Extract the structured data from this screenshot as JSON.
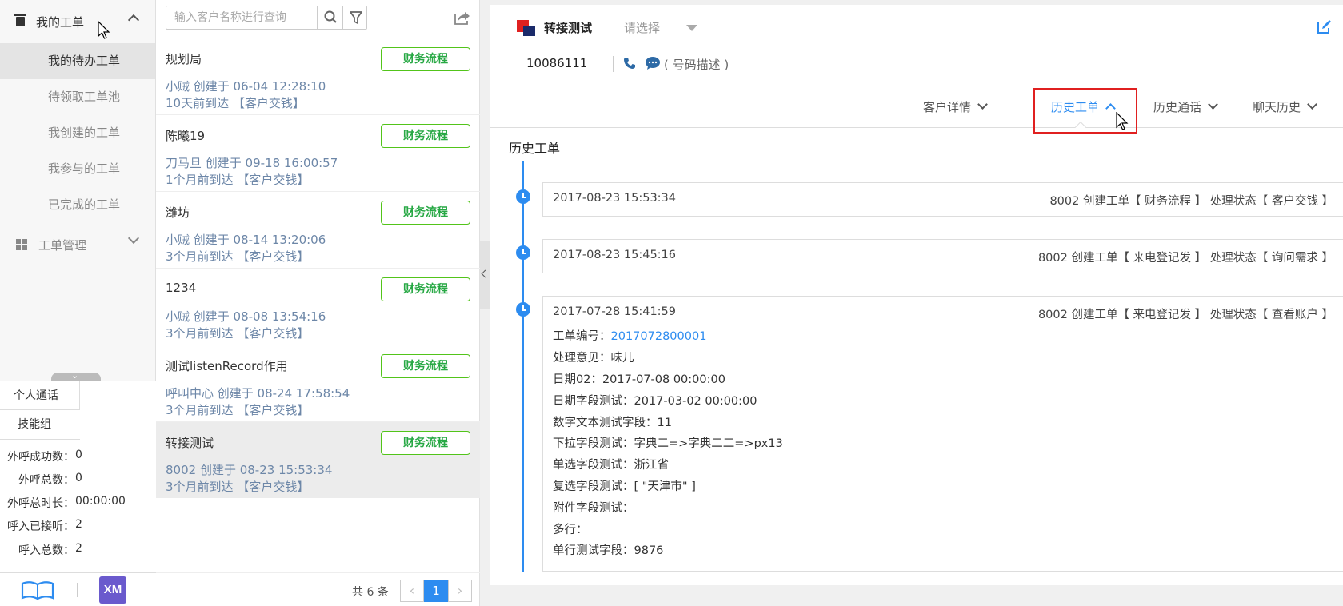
{
  "nav": {
    "my_tickets": "我的工单",
    "sub_items": [
      "我的待办工单",
      "待领取工单池",
      "我创建的工单",
      "我参与的工单",
      "已完成的工单"
    ],
    "ticket_mgmt": "工单管理"
  },
  "stats": {
    "tab_personal": "个人通话",
    "tab_skill": "技能组",
    "rows": [
      {
        "label": "外呼成功数：",
        "value": "0"
      },
      {
        "label": "外呼总数：",
        "value": "0"
      },
      {
        "label": "外呼总时长：",
        "value": "00:00:00"
      },
      {
        "label": "呼入已接听：",
        "value": "2"
      },
      {
        "label": "呼入总数：",
        "value": "2"
      }
    ],
    "logo_text": "XM"
  },
  "list": {
    "search_placeholder": "输入客户名称进行查询",
    "tickets": [
      {
        "name": "规划局",
        "tag": "财务流程",
        "info": "小贼 创建于 06-04 12:28:10",
        "arrival": "10天前到达",
        "status": "【客户交钱】"
      },
      {
        "name": "陈曦19",
        "tag": "财务流程",
        "info": "刀马旦 创建于 09-18 16:00:57",
        "arrival": "1个月前到达",
        "status": "【客户交钱】"
      },
      {
        "name": "潍坊",
        "tag": "财务流程",
        "info": "小贼 创建于 08-14 13:20:06",
        "arrival": "3个月前到达",
        "status": "【客户交钱】"
      },
      {
        "name": "1234",
        "tag": "财务流程",
        "info": "小贼 创建于 08-08 13:54:16",
        "arrival": "3个月前到达",
        "status": "【客户交钱】"
      },
      {
        "name": "测试listenRecord作用",
        "tag": "财务流程",
        "info": "呼叫中心 创建于 08-24 17:58:54",
        "arrival": "3个月前到达",
        "status": "【客户交钱】"
      },
      {
        "name": "转接测试",
        "tag": "财务流程",
        "info": "8002 创建于 08-23 15:53:34",
        "arrival": "3个月前到达",
        "status": "【客户交钱】"
      }
    ],
    "pager": {
      "total": "共 6 条",
      "prev": "‹",
      "page": "1",
      "next": "›"
    }
  },
  "detail": {
    "customer_name": "转接测试",
    "select_placeholder": "请选择",
    "phone": "10086111",
    "number_desc": "( 号码描述 )",
    "tabs": [
      "客户详情",
      "历史工单",
      "历史通话",
      "聊天历史"
    ],
    "section_title": "历史工单",
    "records": [
      {
        "time": "2017-08-23 15:53:34",
        "summary": "8002 创建工单【 财务流程 】 处理状态【 客户交钱 】"
      },
      {
        "time": "2017-08-23 15:45:16",
        "summary": "8002 创建工单【 来电登记发 】 处理状态【 询问需求 】"
      },
      {
        "time": "2017-07-28 15:41:59",
        "summary": "8002 创建工单【 来电登记发 】 处理状态【 查看账户 】",
        "ticket_no_label": "工单编号：",
        "ticket_no": "2017072800001",
        "fields": [
          "处理意见：味儿",
          "日期02：2017-07-08 00:00:00",
          "日期字段测试：2017-03-02 00:00:00",
          "数字文本测试字段：11",
          "下拉字段测试：字典二=>字典二二=>px13",
          "单选字段测试：浙江省",
          "复选字段测试：[ \"天津市\" ]",
          "附件字段测试：",
          "多行：",
          "单行测试字段：9876"
        ]
      }
    ]
  },
  "colors": {
    "accent": "#2d8cf0",
    "tag_green": "#27a844",
    "highlight_red": "#e02020"
  }
}
